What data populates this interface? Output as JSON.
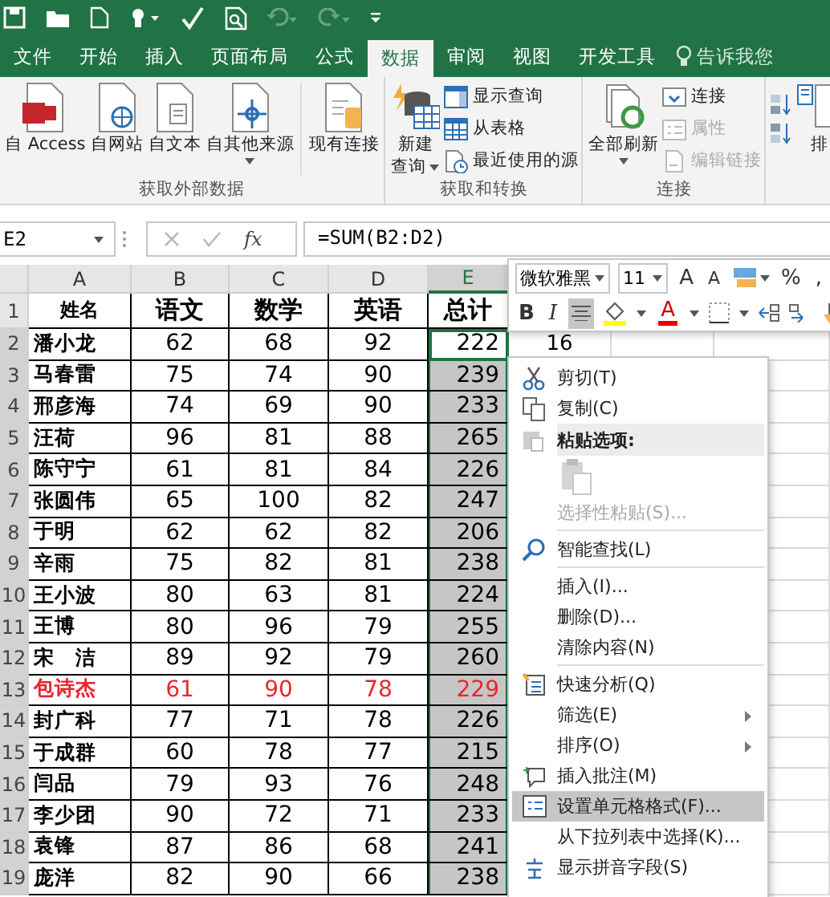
{
  "tabs": [
    {
      "label": "文件",
      "selected": false
    },
    {
      "label": "开始",
      "selected": false
    },
    {
      "label": "插入",
      "selected": false
    },
    {
      "label": "页面布局",
      "selected": false
    },
    {
      "label": "公式",
      "selected": false
    },
    {
      "label": "数据",
      "selected": true
    },
    {
      "label": "审阅",
      "selected": false
    },
    {
      "label": "视图",
      "selected": false
    },
    {
      "label": "开发工具",
      "selected": false
    }
  ],
  "tell_me": {
    "placeholder": "告诉我您"
  },
  "ribbon": {
    "groups": [
      {
        "label": "获取外部数据",
        "buttons": [
          {
            "kind": "large",
            "label": "自 Access",
            "dropdown": false
          },
          {
            "kind": "large",
            "label": "自网站",
            "dropdown": false
          },
          {
            "kind": "large",
            "label": "自文本",
            "dropdown": false
          },
          {
            "kind": "large",
            "label": "自其他来源",
            "dropdown": true
          },
          {
            "kind": "large",
            "label": "现有连接",
            "dropdown": false
          }
        ]
      },
      {
        "label": "获取和转换",
        "buttons": [
          {
            "kind": "large",
            "label": "新建",
            "label_2": "查询",
            "dropdown": true
          },
          {
            "kind": "small",
            "label": "显示查询",
            "disabled": false
          },
          {
            "kind": "small",
            "label": "从表格",
            "disabled": false
          },
          {
            "kind": "small",
            "label": "最近使用的源",
            "disabled": false
          }
        ]
      },
      {
        "label": "连接",
        "buttons": [
          {
            "kind": "large",
            "label": "全部刷新",
            "dropdown": true
          },
          {
            "kind": "small",
            "label": "连接",
            "disabled": false
          },
          {
            "kind": "small",
            "label": "属性",
            "disabled": true
          },
          {
            "kind": "small",
            "label": "编辑链接",
            "disabled": true
          }
        ]
      },
      {
        "buttons": [
          {
            "kind": "large",
            "label": "排",
            "dropdown": false
          }
        ]
      }
    ]
  },
  "formula_bar": {
    "name_box": "E2",
    "function_button": "fx",
    "formula": "=SUM(B2:D2)"
  },
  "sheet": {
    "columns": [
      {
        "label": "A",
        "selected": false
      },
      {
        "label": "B",
        "selected": false
      },
      {
        "label": "C",
        "selected": false
      },
      {
        "label": "D",
        "selected": false
      },
      {
        "label": "E",
        "selected": true
      }
    ],
    "header_row": {
      "number": "1",
      "cells": [
        "姓名",
        "语文",
        "数学",
        "英语",
        "总计"
      ]
    },
    "rows": [
      {
        "number": "2",
        "name": "潘小龙",
        "scores": [
          "62",
          "68",
          "92"
        ],
        "total": "222",
        "color": "#000000",
        "selected": true,
        "active": true,
        "column_6": "16"
      },
      {
        "number": "3",
        "name": "马春雷",
        "scores": [
          "75",
          "74",
          "90"
        ],
        "total": "239",
        "color": "#000000",
        "selected": true,
        "active": false
      },
      {
        "number": "4",
        "name": "邢彦海",
        "scores": [
          "74",
          "69",
          "90"
        ],
        "total": "233",
        "color": "#000000",
        "selected": true,
        "active": false
      },
      {
        "number": "5",
        "name": "汪荷",
        "scores": [
          "96",
          "81",
          "88"
        ],
        "total": "265",
        "color": "#000000",
        "selected": true,
        "active": false
      },
      {
        "number": "6",
        "name": "陈守宁",
        "scores": [
          "61",
          "81",
          "84"
        ],
        "total": "226",
        "color": "#000000",
        "selected": true,
        "active": false
      },
      {
        "number": "7",
        "name": "张圆伟",
        "scores": [
          "65",
          "100",
          "82"
        ],
        "total": "247",
        "color": "#000000",
        "selected": true,
        "active": false
      },
      {
        "number": "8",
        "name": "于明",
        "scores": [
          "62",
          "62",
          "82"
        ],
        "total": "206",
        "color": "#000000",
        "selected": true,
        "active": false
      },
      {
        "number": "9",
        "name": "辛雨",
        "scores": [
          "75",
          "82",
          "81"
        ],
        "total": "238",
        "color": "#000000",
        "selected": true,
        "active": false
      },
      {
        "number": "10",
        "name": "王小波",
        "scores": [
          "80",
          "63",
          "81"
        ],
        "total": "224",
        "color": "#000000",
        "selected": true,
        "active": false
      },
      {
        "number": "11",
        "name": "王博",
        "scores": [
          "80",
          "96",
          "79"
        ],
        "total": "255",
        "color": "#000000",
        "selected": true,
        "active": false
      },
      {
        "number": "12",
        "name": "宋　洁",
        "scores": [
          "89",
          "92",
          "79"
        ],
        "total": "260",
        "color": "#000000",
        "selected": true,
        "active": false
      },
      {
        "number": "13",
        "name": "包诗杰",
        "scores": [
          "61",
          "90",
          "78"
        ],
        "total": "229",
        "color": "#e8262b",
        "selected": true,
        "active": false
      },
      {
        "number": "14",
        "name": "封广科",
        "scores": [
          "77",
          "71",
          "78"
        ],
        "total": "226",
        "color": "#000000",
        "selected": true,
        "active": false
      },
      {
        "number": "15",
        "name": "于成群",
        "scores": [
          "60",
          "78",
          "77"
        ],
        "total": "215",
        "color": "#000000",
        "selected": true,
        "active": false
      },
      {
        "number": "16",
        "name": "闫品",
        "scores": [
          "79",
          "93",
          "76"
        ],
        "total": "248",
        "color": "#000000",
        "selected": true,
        "active": false
      },
      {
        "number": "17",
        "name": "李少团",
        "scores": [
          "90",
          "72",
          "71"
        ],
        "total": "233",
        "color": "#000000",
        "selected": true,
        "active": false
      },
      {
        "number": "18",
        "name": "袁锋",
        "scores": [
          "87",
          "86",
          "68"
        ],
        "total": "241",
        "color": "#000000",
        "selected": true,
        "active": false
      },
      {
        "number": "19",
        "name": "庞洋",
        "scores": [
          "82",
          "90",
          "66"
        ],
        "total": "238",
        "color": "#000000",
        "selected": true,
        "active": false
      }
    ]
  },
  "mini_toolbar": {
    "font": "微软雅黑",
    "size": "11",
    "grow": "A",
    "shrink": "A",
    "percent": "%",
    "comma": ",",
    "bold": "B",
    "italic": "I",
    "font_color": "A",
    "center_selected": true
  },
  "context_menu": [
    {
      "kind": "item",
      "label": "剪切(T)",
      "disabled": false,
      "selected": false,
      "submenu": false,
      "separator_before": false
    },
    {
      "kind": "item",
      "label": "复制(C)",
      "disabled": false,
      "selected": false,
      "submenu": false,
      "separator_before": false
    },
    {
      "kind": "header",
      "label": "粘贴选项:"
    },
    {
      "kind": "paste"
    },
    {
      "kind": "item",
      "label": "选择性粘贴(S)...",
      "disabled": true,
      "selected": false,
      "submenu": false,
      "separator_before": false
    },
    {
      "kind": "item",
      "label": "智能查找(L)",
      "disabled": false,
      "selected": false,
      "submenu": false,
      "separator_before": true
    },
    {
      "kind": "item",
      "label": "插入(I)...",
      "disabled": false,
      "selected": false,
      "submenu": false,
      "separator_before": true
    },
    {
      "kind": "item",
      "label": "删除(D)...",
      "disabled": false,
      "selected": false,
      "submenu": false,
      "separator_before": false
    },
    {
      "kind": "item",
      "label": "清除内容(N)",
      "disabled": false,
      "selected": false,
      "submenu": false,
      "separator_before": false
    },
    {
      "kind": "item",
      "label": "快速分析(Q)",
      "disabled": false,
      "selected": false,
      "submenu": false,
      "separator_before": true
    },
    {
      "kind": "item",
      "label": "筛选(E)",
      "disabled": false,
      "selected": false,
      "submenu": true,
      "separator_before": false
    },
    {
      "kind": "item",
      "label": "排序(O)",
      "disabled": false,
      "selected": false,
      "submenu": true,
      "separator_before": false
    },
    {
      "kind": "item",
      "label": "插入批注(M)",
      "disabled": false,
      "selected": false,
      "submenu": false,
      "separator_before": false
    },
    {
      "kind": "item",
      "label": "设置单元格格式(F)...",
      "disabled": false,
      "selected": true,
      "submenu": false,
      "separator_before": false
    },
    {
      "kind": "item",
      "label": "从下拉列表中选择(K)...",
      "disabled": false,
      "selected": false,
      "submenu": false,
      "separator_before": false
    },
    {
      "kind": "item",
      "label": "显示拼音字段(S)",
      "disabled": false,
      "selected": false,
      "submenu": false,
      "separator_before": false
    }
  ]
}
